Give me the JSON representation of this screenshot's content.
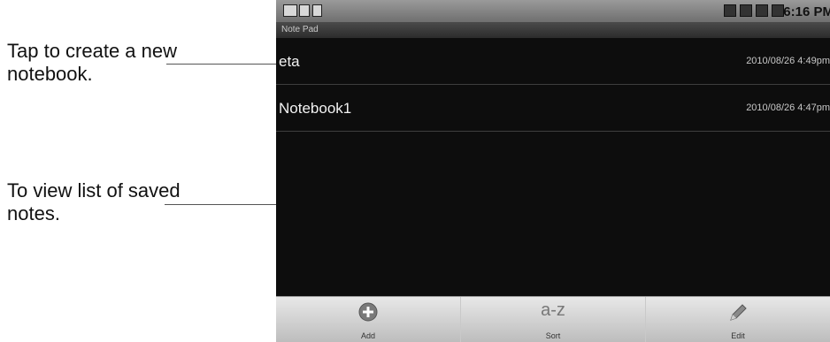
{
  "callouts": {
    "create": "Tap to create a new notebook.",
    "view": "To view list of saved notes."
  },
  "statusbar": {
    "time": "6:16 PM",
    "icons": [
      "mail-icon",
      "usb-icon",
      "sd-card-icon",
      "battery-icon",
      "mute-icon",
      "signal-icon",
      "sync-icon"
    ]
  },
  "app": {
    "title": "Note Pad"
  },
  "notebooks": [
    {
      "name": "eta",
      "date": "2010/08/26 4:49pm"
    },
    {
      "name": "Notebook1",
      "date": "2010/08/26 4:47pm"
    }
  ],
  "toolbar": {
    "add_label": "Add",
    "sort_label": "Sort",
    "sort_glyph": "a-z",
    "edit_label": "Edit"
  },
  "colors": {
    "list_background": "#0d0d0d",
    "toolbar_background": "#d6d6d6",
    "statusbar_background": "#8a8a8a"
  }
}
